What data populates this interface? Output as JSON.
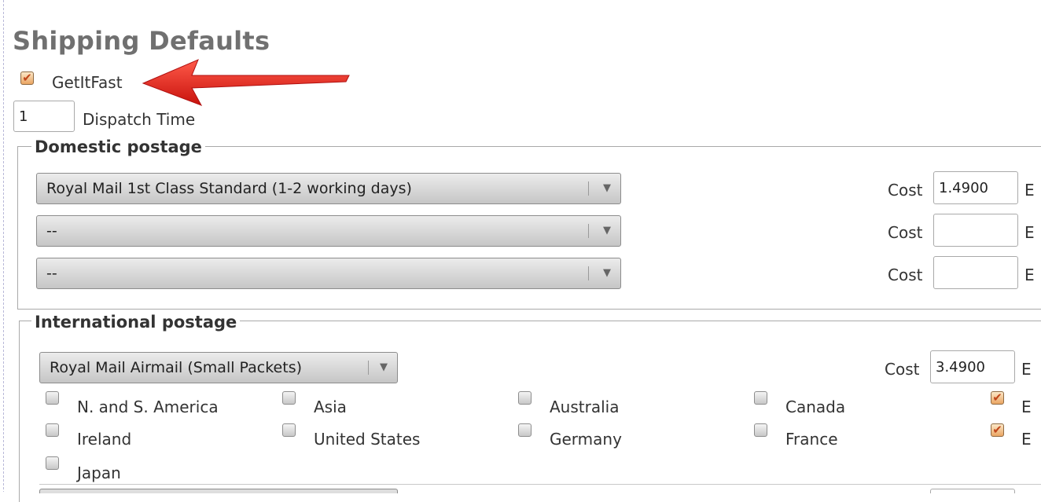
{
  "title": "Shipping Defaults",
  "get_it_fast": {
    "label": "GetItFast",
    "checked": true
  },
  "dispatch": {
    "value": "1",
    "label": "Dispatch Time"
  },
  "domestic": {
    "legend": "Domestic postage",
    "services": [
      {
        "service": "Royal Mail 1st Class Standard (1-2 working days)",
        "cost_label": "Cost",
        "cost": "1.4900",
        "extra": "E"
      },
      {
        "service": "--",
        "cost_label": "Cost",
        "cost": "",
        "extra": "E"
      },
      {
        "service": "--",
        "cost_label": "Cost",
        "cost": "",
        "extra": "E"
      }
    ]
  },
  "international": {
    "legend": "International postage",
    "service": "Royal Mail Airmail (Small Packets)",
    "cost_label": "Cost",
    "cost": "3.4900",
    "extra": "E",
    "destinations": [
      {
        "label": "N. and S. America",
        "checked": false
      },
      {
        "label": "Asia",
        "checked": false
      },
      {
        "label": "Australia",
        "checked": false
      },
      {
        "label": "Canada",
        "checked": false
      },
      {
        "label": "E",
        "checked": true
      },
      {
        "label": "Ireland",
        "checked": false
      },
      {
        "label": "United States",
        "checked": false
      },
      {
        "label": "Germany",
        "checked": false
      },
      {
        "label": "France",
        "checked": false
      },
      {
        "label": "E",
        "checked": true
      },
      {
        "label": "Japan",
        "checked": false
      }
    ]
  },
  "icons": {
    "checkmark": "✔",
    "dropdown": "▼"
  },
  "colors": {
    "annotation_arrow": "#e8221b",
    "checked_fill": "#eaa562"
  }
}
